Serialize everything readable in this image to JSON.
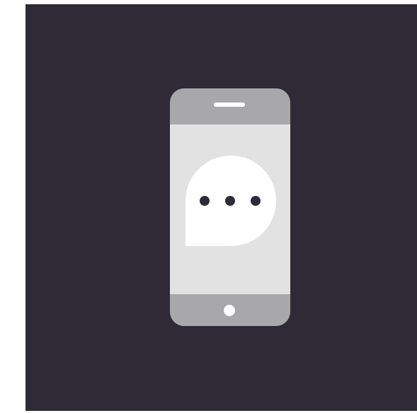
{
  "colors": {
    "background": "#2e2b37",
    "phone_body": "#a8a7aa",
    "phone_screen": "#e2e2e2",
    "bubble": "#ffffff",
    "dots": "#2e2b37",
    "speaker": "#ffffff",
    "home_button": "#ffffff"
  },
  "icons": {
    "phone": "smartphone-icon",
    "bubble": "chat-bubble-icon",
    "dots": "typing-dots-icon"
  }
}
